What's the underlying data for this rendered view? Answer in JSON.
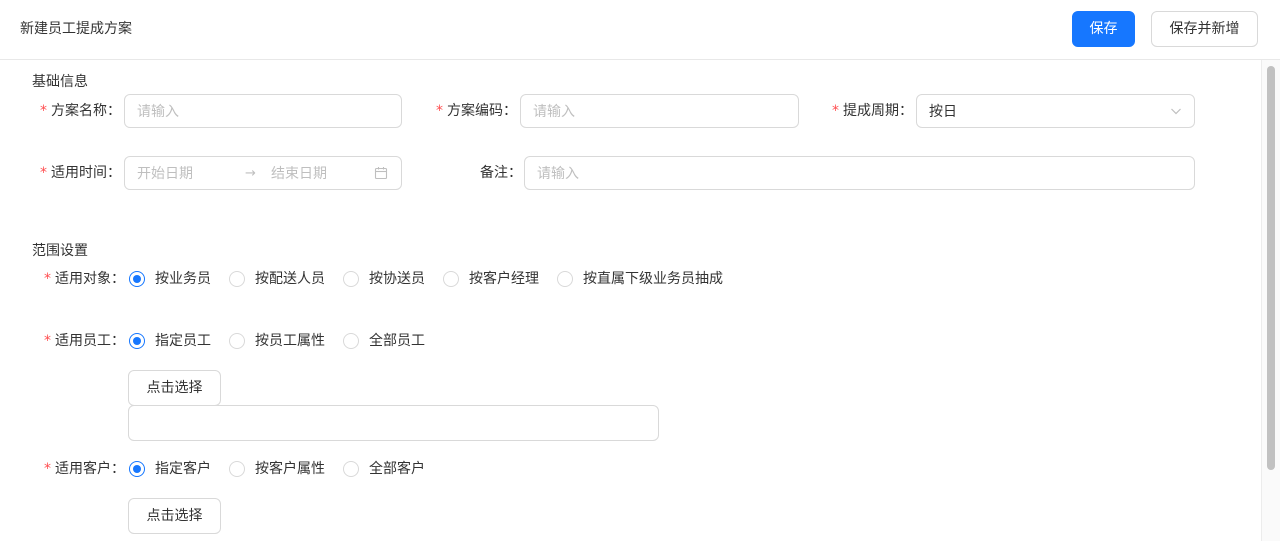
{
  "header": {
    "title": "新建员工提成方案",
    "save_label": "保存",
    "save_add_label": "保存并新增"
  },
  "basic": {
    "section_title": "基础信息",
    "plan_name": {
      "label": "方案名称：",
      "placeholder": "请输入"
    },
    "plan_code": {
      "label": "方案编码：",
      "placeholder": "请输入"
    },
    "cycle": {
      "label": "提成周期：",
      "value": "按日"
    },
    "period": {
      "label": "适用时间：",
      "start_placeholder": "开始日期",
      "arrow": "→",
      "end_placeholder": "结束日期"
    },
    "remark": {
      "label": "备注：",
      "placeholder": "请输入"
    }
  },
  "scope": {
    "section_title": "范围设置",
    "target": {
      "label": "适用对象：",
      "options": [
        "按业务员",
        "按配送人员",
        "按协送员",
        "按客户经理",
        "按直属下级业务员抽成"
      ],
      "selected": "按业务员"
    },
    "employee": {
      "label": "适用员工：",
      "options": [
        "指定员工",
        "按员工属性",
        "全部员工"
      ],
      "selected": "指定员工",
      "select_button": "点击选择"
    },
    "customer": {
      "label": "适用客户：",
      "options": [
        "指定客户",
        "按客户属性",
        "全部客户"
      ],
      "selected": "指定客户",
      "select_button": "点击选择"
    }
  },
  "required_mark": "*",
  "colors": {
    "primary": "#1677ff",
    "required": "#ff4d4f",
    "border": "#d9d9d9",
    "placeholder": "#bfbfbf"
  }
}
